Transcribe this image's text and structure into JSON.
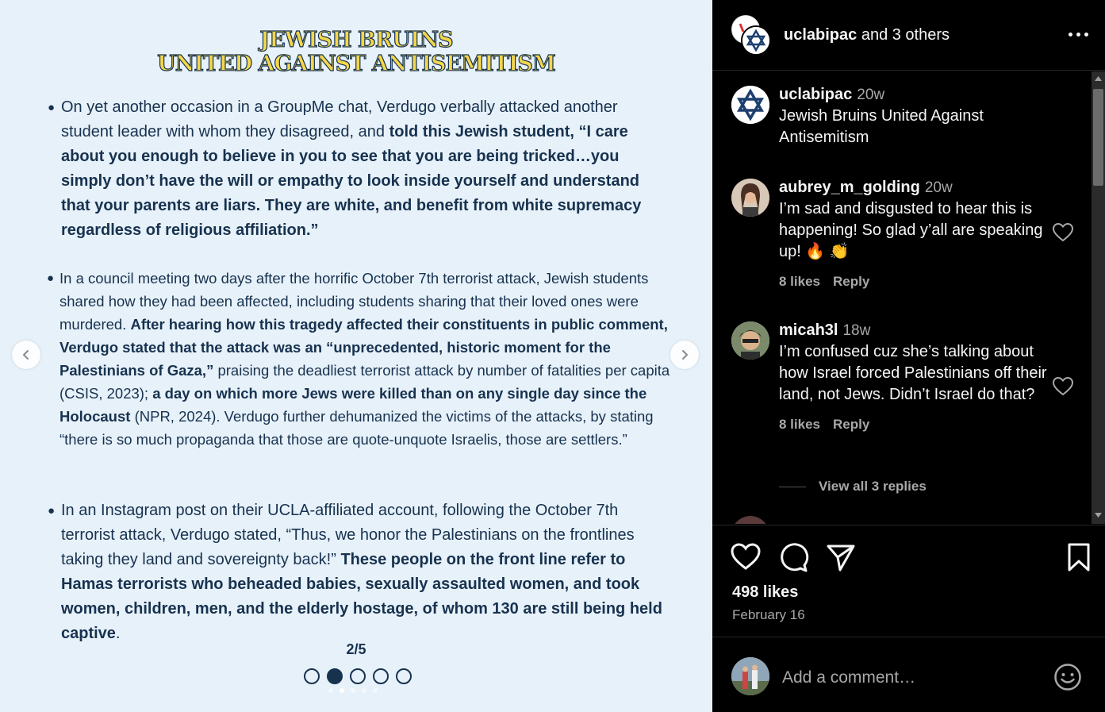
{
  "slide": {
    "title_line1": "JEWISH BRUINS",
    "title_line2": "UNITED AGAINST ANTISEMITISM",
    "bullet1": {
      "normal1": "On yet another occasion in a GroupMe chat, Verdugo verbally attacked another student leader with whom they disagreed, and ",
      "bold1": "told this Jewish student, “I care about you enough to believe in you to see that you are being tricked…you simply don’t have the will or empathy to look inside yourself and understand that your parents are liars. They are white, and benefit from white supremacy regardless of religious affiliation.”"
    },
    "bullet2": {
      "normal1": "In a council meeting two days after the horrific October 7th terrorist attack,  Jewish students shared how they had been affected, including students sharing that their loved ones were murdered. ",
      "bold1": "After hearing how this tragedy affected their constituents in public comment, Verdugo stated that the attack was an “unprecedented, historic moment for the Palestinians of Gaza,”",
      "normal2": " praising the deadliest terrorist attack by number of fatalities per capita (CSIS, 2023); ",
      "bold2": "a day on which more Jews were killed than on any single day since the Holocaust",
      "normal3": " (NPR, 2024). Verdugo further dehumanized the victims of the attacks, by stating “there is so much propaganda that those are quote-unquote Israelis, those are settlers.”"
    },
    "bullet3": {
      "normal1": "In an Instagram post on their UCLA-affiliated account, following the October 7th terrorist attack, Verdugo stated, “Thus, we honor the Palestinians on the frontlines taking they land and sovereignty back!” ",
      "bold1": "These people on the front line refer to Hamas terrorists who beheaded babies, sexually assaulted women, and took women, children, men, and the elderly hostage, of whom 130 are still being held captive",
      "normal2": "."
    },
    "page_label": "2/5",
    "page_total": 5,
    "page_current": 2
  },
  "post": {
    "header_user": "uclabipac",
    "header_rest": " and 3 others",
    "caption": {
      "user": "uclabipac",
      "time": "20w",
      "text": "Jewish Bruins United Against Antisemitism"
    },
    "comments": [
      {
        "user": "aubrey_m_golding",
        "time": "20w",
        "text": "I’m sad and disgusted to hear this is happening! So glad y’all are speaking up! 🔥 👏",
        "likes": "8 likes",
        "reply": "Reply"
      },
      {
        "user": "micah3l",
        "time": "18w",
        "text": "I’m confused cuz she’s talking about how Israel forced Palestinians off their land, not Jews. Didn’t Israel do that?",
        "likes": "8 likes",
        "reply": "Reply",
        "view_replies": "View all 3 replies"
      }
    ],
    "likes": "498 likes",
    "date": "February 16",
    "comment_placeholder": "Add a comment…"
  },
  "colors": {
    "slide_bg": "#e7f1f9",
    "navy": "#17324f",
    "title_yellow": "#f3d64b",
    "panel_bg": "#000000",
    "muted": "#a8a8a8"
  }
}
